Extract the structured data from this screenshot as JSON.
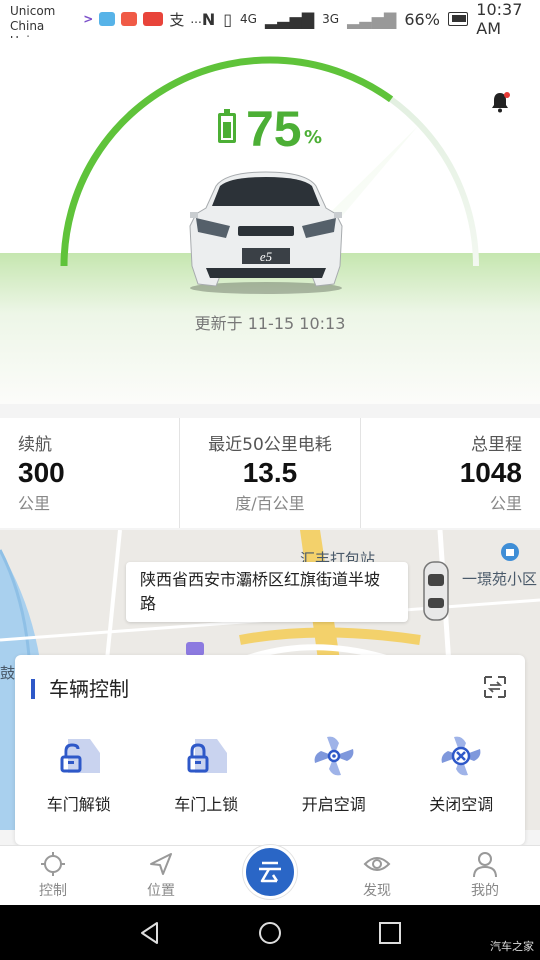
{
  "status_bar": {
    "carrier_1": "China Unicom",
    "carrier_2": "China Unicom",
    "network_1": "4G",
    "network_2": "3G",
    "battery": "66%",
    "time": "10:37 AM",
    "more": "..."
  },
  "hero": {
    "battery_percent": "75",
    "battery_percent_unit": "%",
    "battery_level": 0.75,
    "updated_text": "更新于 11-15 10:13",
    "car_badge": "e5",
    "accent_color": "#4caf35"
  },
  "stats": [
    {
      "label": "续航",
      "value": "300",
      "unit": "公里"
    },
    {
      "label": "最近50公里电耗",
      "value": "13.5",
      "unit": "度/百公里"
    },
    {
      "label": "总里程",
      "value": "1048",
      "unit": "公里"
    }
  ],
  "map": {
    "address": "陕西省西安市灞桥区红旗街道半坡路",
    "label_poi_1": "汇丰打包站",
    "label_poi_2": "一璟苑小区",
    "label_left": "鼓"
  },
  "control": {
    "title": "车辆控制",
    "items": [
      {
        "label": "车门解锁",
        "icon": "door-unlock-icon"
      },
      {
        "label": "车门上锁",
        "icon": "door-lock-icon"
      },
      {
        "label": "开启空调",
        "icon": "ac-on-icon"
      },
      {
        "label": "关闭空调",
        "icon": "ac-off-icon"
      }
    ],
    "accent_color": "#2e58c8"
  },
  "bottom_nav": {
    "items": [
      {
        "label": "控制",
        "icon": "control-icon"
      },
      {
        "label": "位置",
        "icon": "location-icon"
      },
      {
        "label": "发现",
        "icon": "eye-icon"
      },
      {
        "label": "我的",
        "icon": "user-icon"
      }
    ],
    "center_icon": "home-logo-icon"
  },
  "watermark": "汽车之家"
}
